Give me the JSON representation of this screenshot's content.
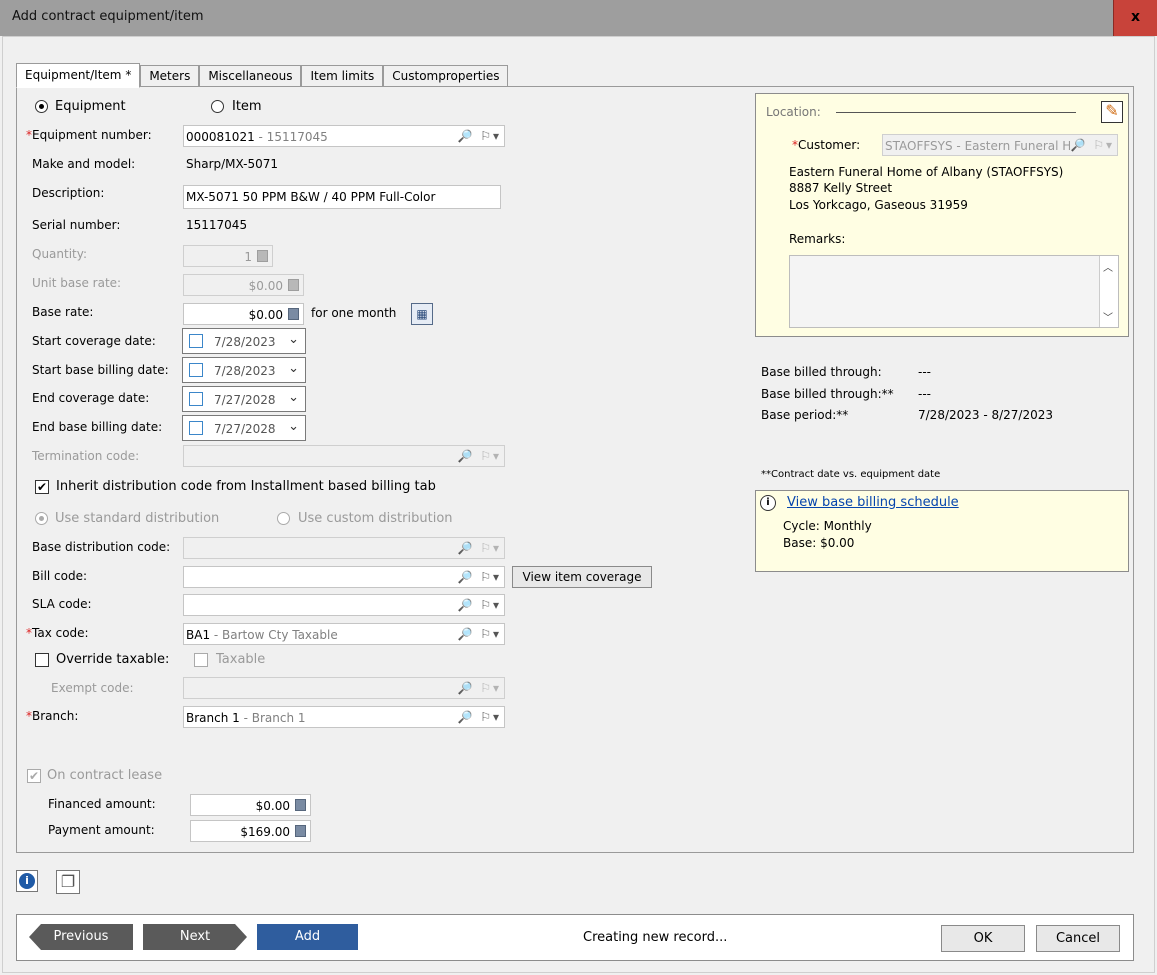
{
  "window": {
    "title": "Add contract equipment/item",
    "close_label": "x"
  },
  "tabs": [
    "Equipment/Item *",
    "Meters",
    "Miscellaneous",
    "Item limits",
    "Customproperties"
  ],
  "type_radio": {
    "equipment": "Equipment",
    "item": "Item",
    "selected": "Equipment"
  },
  "labels": {
    "equipment_number": "Equipment number:",
    "make_model": "Make and model:",
    "description": "Description:",
    "serial_number": "Serial number:",
    "quantity": "Quantity:",
    "unit_base_rate": "Unit base rate:",
    "base_rate": "Base rate:",
    "start_coverage": "Start coverage date:",
    "start_base_billing": "Start base billing date:",
    "end_coverage": "End coverage date:",
    "end_base_billing": "End base billing date:",
    "termination_code": "Termination code:",
    "base_distribution_code": "Base distribution code:",
    "bill_code": "Bill code:",
    "sla_code": "SLA code:",
    "tax_code": "Tax code:",
    "override_taxable": "Override taxable:",
    "taxable": "Taxable",
    "exempt_code": "Exempt code:",
    "branch": "Branch:",
    "on_contract_lease": "On contract lease",
    "financed_amount": "Financed amount:",
    "payment_amount": "Payment amount:",
    "for_one_month": "for one month",
    "required_mark": "*"
  },
  "values": {
    "equipment_number_code": "000081021",
    "equipment_number_desc": " - 15117045",
    "make_model": "Sharp/MX-5071",
    "description": "MX-5071 50 PPM B&W / 40 PPM Full-Color",
    "serial_number": "15117045",
    "quantity": "1",
    "unit_base_rate": "$0.00",
    "base_rate": "$0.00",
    "start_coverage": "7/28/2023",
    "start_base_billing": "7/28/2023",
    "end_coverage": "7/27/2028",
    "end_base_billing": "7/27/2028",
    "tax_code": "BA1",
    "tax_code_desc": " - Bartow Cty Taxable",
    "branch": "Branch 1",
    "branch_desc": " - Branch 1",
    "financed_amount": "$0.00",
    "payment_amount": "$169.00"
  },
  "distribution": {
    "inherit_label": "Inherit distribution code from Installment based billing tab",
    "inherit_checked": true,
    "standard": "Use standard distribution",
    "custom": "Use custom distribution"
  },
  "buttons": {
    "view_item_coverage": "View item coverage",
    "previous": "Previous",
    "next": "Next",
    "add": "Add",
    "ok": "OK",
    "cancel": "Cancel"
  },
  "location": {
    "header": "Location:",
    "customer_label": "Customer:",
    "customer_value": "STAOFFSYS - Eastern Funeral H",
    "address_line1": "Eastern Funeral Home of Albany (STAOFFSYS)",
    "address_line2": "8887 Kelly Street",
    "address_line3": "Los Yorkcago, Gaseous 31959",
    "remarks_label": "Remarks:"
  },
  "billing_info": {
    "base_billed_through_label": "Base billed through:",
    "base_billed_through_value": "---",
    "base_billed_through2_label": "Base billed through:**",
    "base_billed_through2_value": "---",
    "base_period_label": "Base period:**",
    "base_period_value": "7/28/2023 - 8/27/2023",
    "footnote": "**Contract date vs. equipment date"
  },
  "schedule": {
    "link": "View base billing schedule",
    "cycle": "Cycle: Monthly",
    "base": "Base: $0.00"
  },
  "status": {
    "text": "Creating new record..."
  },
  "icons": {
    "search": "🔎",
    "flag_menu": "⚐▾",
    "chevron": "⌄",
    "edit": "✎",
    "info": "i",
    "copy": "❐",
    "calendar": "▦"
  },
  "colors": {
    "required": "#dd2222",
    "accent_blue": "#2f5d9e",
    "note_bg": "#fffee3",
    "close_bg": "#c8433a"
  }
}
